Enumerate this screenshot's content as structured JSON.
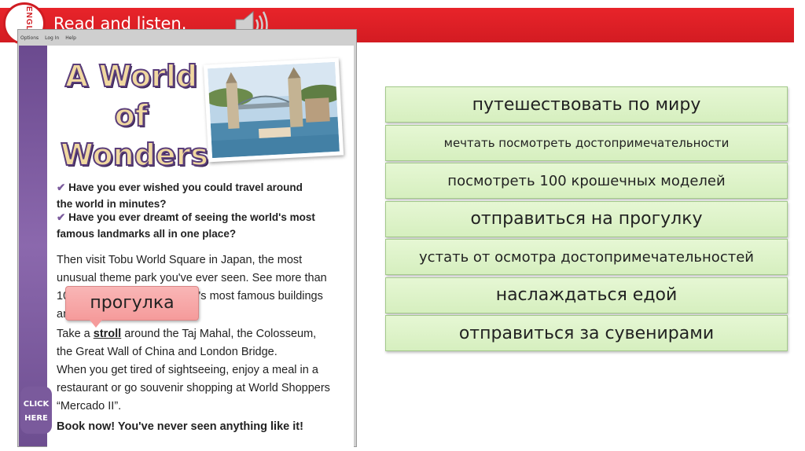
{
  "header": {
    "title": "Read and listen.",
    "logo_text": "ENGLISH",
    "speaker_icon": "speaker-icon"
  },
  "book": {
    "menu": [
      "Options",
      "Log In",
      "Help"
    ],
    "title_lines": [
      "A World",
      "of",
      "Wonders"
    ],
    "questions": [
      "Have you ever wished you could travel around the world in minutes?",
      "Have you ever dreamt of seeing the world's most famous landmarks all in one place?"
    ],
    "paragraph": {
      "p1": "Then visit Tobu World Square in Japan, the most unusual theme park you've ever seen. See more than 100 tiny models of the world's most famous buildings and monuments.",
      "p2_before": "Take a ",
      "stroll": "stroll",
      "p2_after": " around the Taj Mahal, the Colosseum, the Great Wall of China and London Bridge.",
      "p3": "When you get tired of sightseeing, enjoy a meal in a restaurant or go souvenir shopping at World Shoppers “Mercado II”."
    },
    "closing": "Book now! You've never seen anything like it!",
    "click_here": "CLICK HERE",
    "tick_icon": "check-icon"
  },
  "callout": "прогулка",
  "phrases": [
    {
      "text": "путешествовать по миру",
      "size": "lg"
    },
    {
      "text": "мечтать посмотреть достопримечательности",
      "size": "sm"
    },
    {
      "text": "посмотреть 100 крошечных моделей",
      "size": "md"
    },
    {
      "text": "отправиться на прогулку",
      "size": "lg"
    },
    {
      "text": "устать от осмотра достопримечательностей",
      "size": "md"
    },
    {
      "text": "наслаждаться едой",
      "size": "lg"
    },
    {
      "text": "отправиться за сувенирами",
      "size": "lg"
    }
  ],
  "colors": {
    "header_red": "#d31b22",
    "phrase_green": "#d6efbf",
    "callout_pink": "#f59b9b",
    "book_purple": "#7a5a9c"
  }
}
